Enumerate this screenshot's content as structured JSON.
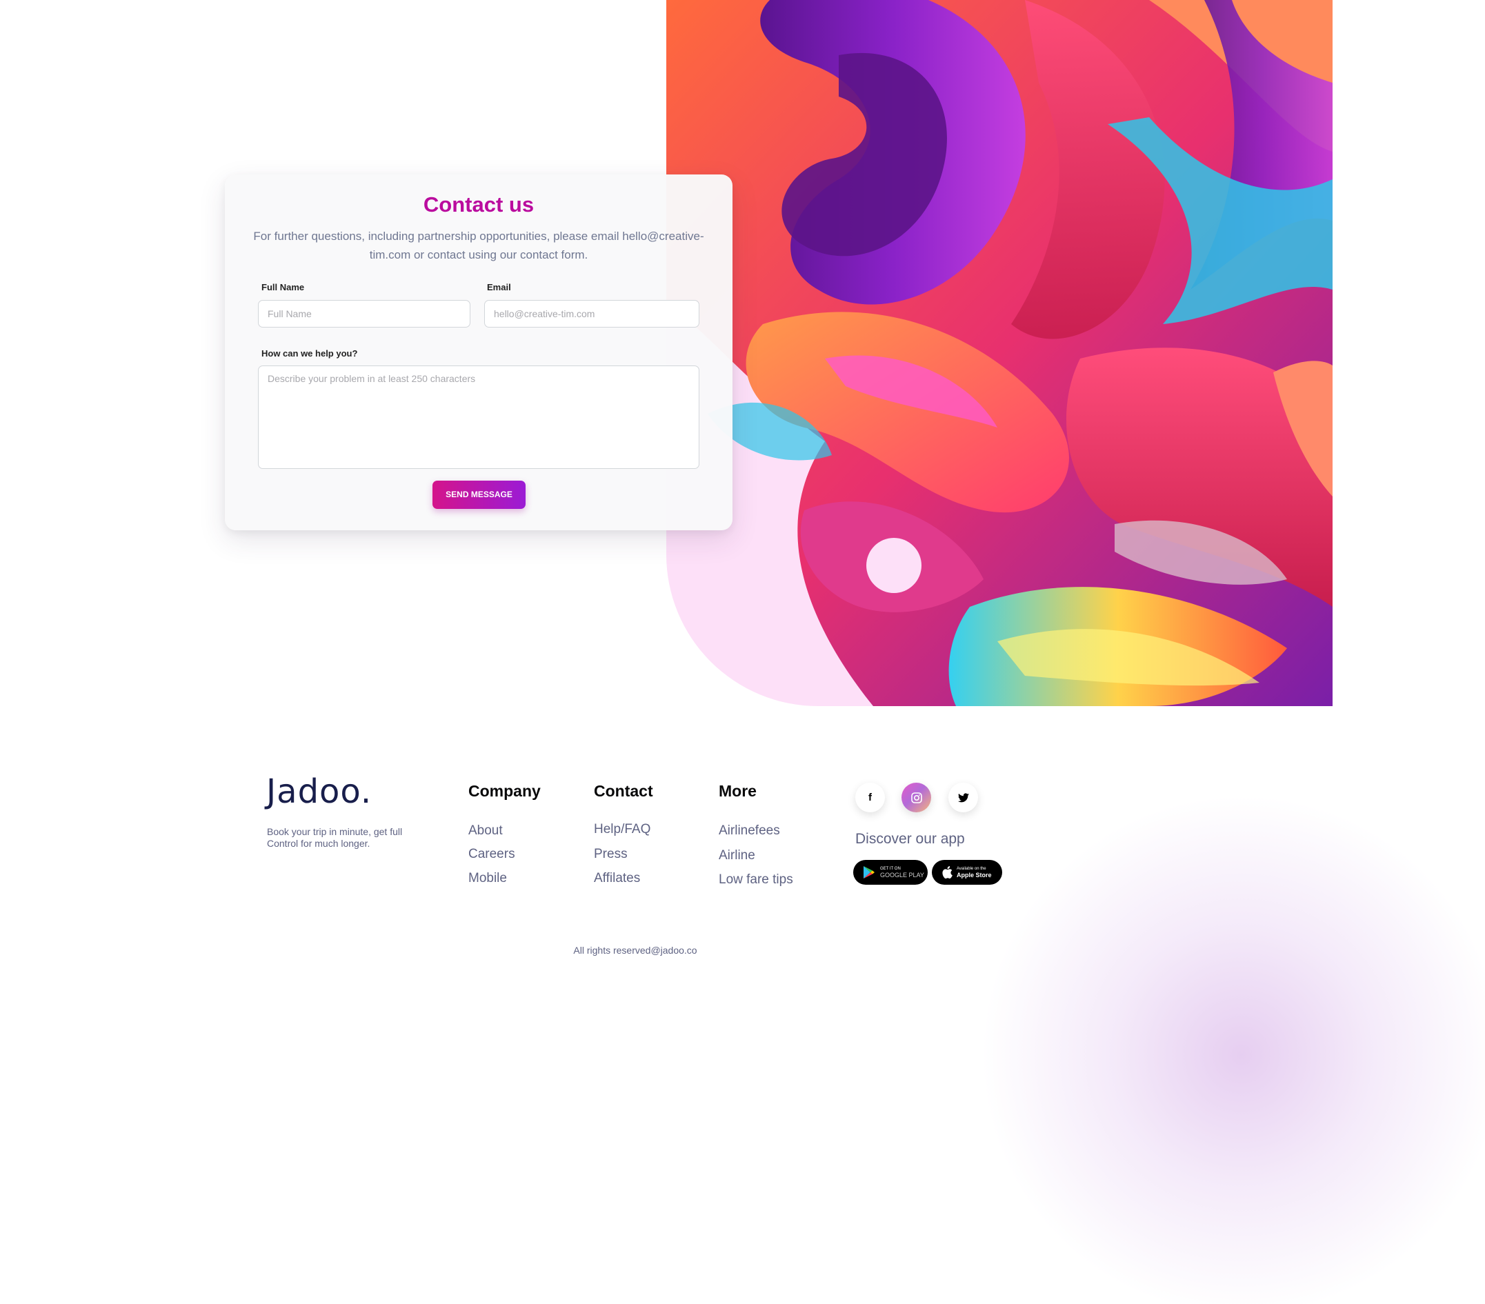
{
  "contact": {
    "title": "Contact us",
    "description": "For further questions, including partnership opportunities, please email hello@creative-tim.com or contact using our contact form.",
    "full_name_label": "Full Name",
    "full_name_placeholder": "Full Name",
    "email_label": "Email",
    "email_placeholder": "hello@creative-tim.com",
    "message_label": "How can we help you?",
    "message_placeholder": "Describe your problem in at least 250 characters",
    "send_label": "SEND MESSAGE"
  },
  "footer": {
    "logo": "Jadoo.",
    "tagline": "Book your trip in minute, get full Control for much longer.",
    "columns": [
      {
        "title": "Company",
        "links": [
          "About",
          "Careers",
          "Mobile"
        ]
      },
      {
        "title": "Contact",
        "links": [
          "Help/FAQ",
          "Press",
          "Affilates"
        ]
      },
      {
        "title": "More",
        "links": [
          "Airlinefees",
          "Airline",
          "Low fare tips"
        ]
      }
    ],
    "social": [
      "facebook-icon",
      "instagram-icon",
      "twitter-icon"
    ],
    "discover": "Discover our app",
    "google_play": {
      "small": "GET IT ON",
      "big": "GOOGLE PLAY"
    },
    "app_store": {
      "small": "Available on the",
      "big": "Apple Store"
    },
    "rights": "All rights reserved@jadoo.co"
  },
  "colors": {
    "accent": "#ba0c9e",
    "button_start": "#d4148b",
    "button_end": "#9b1bd5",
    "heading": "#181e4b",
    "muted": "#5e6282",
    "art_bg": "#fde0f8"
  }
}
